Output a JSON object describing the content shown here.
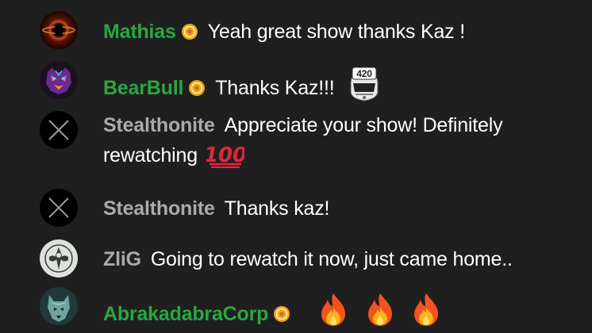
{
  "colors": {
    "background": "#1f1f1f",
    "member_name": "#2ba640",
    "viewer_name": "#aaaaaa",
    "message_text": "#ffffff",
    "badge_fill": "#f2a516"
  },
  "messages": [
    {
      "author": "Mathias",
      "author_type": "member",
      "avatar_icon": "black-hole-avatar",
      "badge_icon": "member-badge-icon",
      "text": "Yeah great show thanks Kaz !"
    },
    {
      "author": "BearBull",
      "author_type": "member",
      "avatar_icon": "neon-bear-avatar",
      "badge_icon": "member-badge-icon",
      "text": "Thanks Kaz!!!",
      "emote": "420-helmet-emote",
      "emote_text": "420"
    },
    {
      "author": "Stealthonite",
      "author_type": "viewer",
      "avatar_icon": "crossed-circle-avatar",
      "text": "Appreciate your show! Definitely rewatching",
      "emoji": "hundred-points-emoji"
    },
    {
      "author": "Stealthonite",
      "author_type": "viewer",
      "avatar_icon": "crossed-circle-avatar",
      "text": "Thanks kaz!"
    },
    {
      "author": "ZliG",
      "author_type": "viewer",
      "avatar_icon": "ornament-avatar",
      "text": "Going to rewatch it now, just came home.."
    },
    {
      "author": "AbrakadabraCorp",
      "author_type": "member",
      "avatar_icon": "wolf-avatar",
      "badge_icon": "member-badge-icon",
      "emojis": [
        "fire-emoji",
        "fire-emoji",
        "fire-emoji"
      ]
    }
  ]
}
